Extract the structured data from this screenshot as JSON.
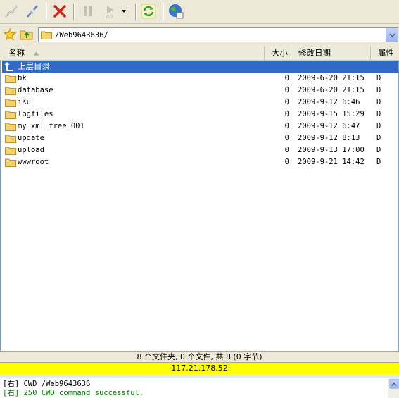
{
  "toolbar": {
    "buttons": [
      "connect-icon",
      "disconnect-icon",
      "stop-icon",
      "pause-icon",
      "play-icon",
      "refresh-icon",
      "globe-icon"
    ]
  },
  "address": {
    "path": "/Web9643636/"
  },
  "list": {
    "columns": {
      "name": "名称",
      "size": "大小",
      "modified": "修改日期",
      "attr": "属性"
    },
    "parent_label": "上层目录",
    "rows": [
      {
        "name": "bk",
        "size": "0",
        "date": "2009-6-20 21:15",
        "attr": "D"
      },
      {
        "name": "database",
        "size": "0",
        "date": "2009-6-20 21:15",
        "attr": "D"
      },
      {
        "name": "iKu",
        "size": "0",
        "date": "2009-9-12 6:46",
        "attr": "D"
      },
      {
        "name": "logfiles",
        "size": "0",
        "date": "2009-9-15 15:29",
        "attr": "D"
      },
      {
        "name": "my_xml_free_001",
        "size": "0",
        "date": "2009-9-12 6:47",
        "attr": "D"
      },
      {
        "name": "update",
        "size": "0",
        "date": "2009-9-12 8:13",
        "attr": "D"
      },
      {
        "name": "upload",
        "size": "0",
        "date": "2009-9-13 17:00",
        "attr": "D"
      },
      {
        "name": "wwwroot",
        "size": "0",
        "date": "2009-9-21 14:42",
        "attr": "D"
      }
    ]
  },
  "status": {
    "summary": "8 个文件夹, 0 个文件, 共 8 (0 字节)",
    "ip": "117.21.178.52"
  },
  "log": {
    "lines": [
      {
        "prefix": "[右]",
        "text": "CWD /Web9643636",
        "color": "#000000"
      },
      {
        "prefix": "[右]",
        "text": "250 CWD command successful.",
        "color": "#008000"
      }
    ]
  },
  "colors": {
    "selection": "#316ac5",
    "ip_bar": "#ffff00",
    "folder": "#f4d46a",
    "stop_x": "#d2231a"
  }
}
